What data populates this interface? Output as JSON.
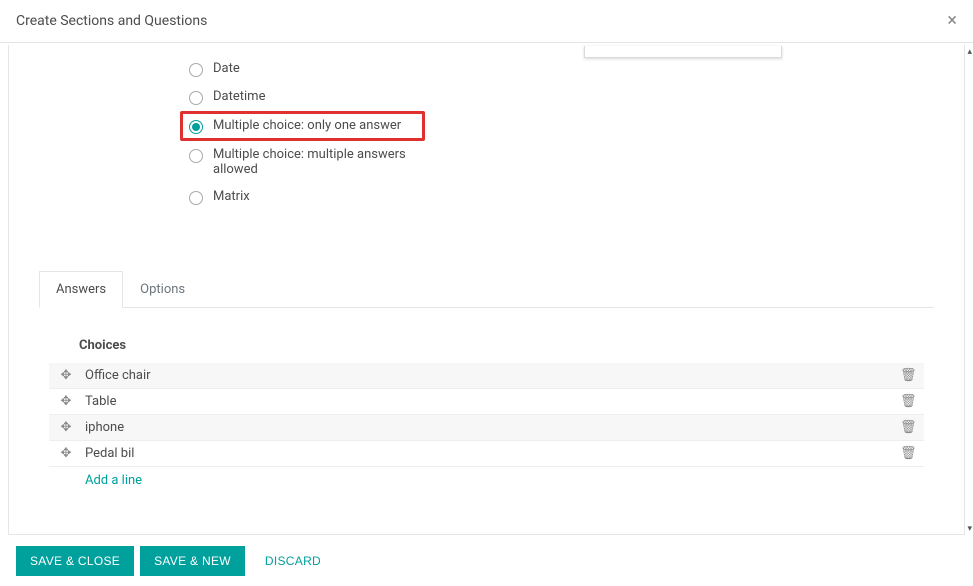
{
  "header": {
    "title": "Create Sections and Questions"
  },
  "question_types": [
    {
      "label": "Date",
      "checked": false,
      "highlighted": false
    },
    {
      "label": "Datetime",
      "checked": false,
      "highlighted": false
    },
    {
      "label": "Multiple choice: only one answer",
      "checked": true,
      "highlighted": true
    },
    {
      "label": "Multiple choice: multiple answers allowed",
      "checked": false,
      "highlighted": false
    },
    {
      "label": "Matrix",
      "checked": false,
      "highlighted": false
    }
  ],
  "tabs": {
    "items": [
      {
        "label": "Answers",
        "active": true
      },
      {
        "label": "Options",
        "active": false
      }
    ]
  },
  "answers": {
    "choices_label": "Choices",
    "rows": [
      {
        "text": "Office chair"
      },
      {
        "text": "Table"
      },
      {
        "text": "iphone"
      },
      {
        "text": "Pedal bil"
      }
    ],
    "add_line": "Add a line"
  },
  "footer": {
    "save_close": "Save & Close",
    "save_new": "Save & New",
    "discard": "Discard"
  }
}
